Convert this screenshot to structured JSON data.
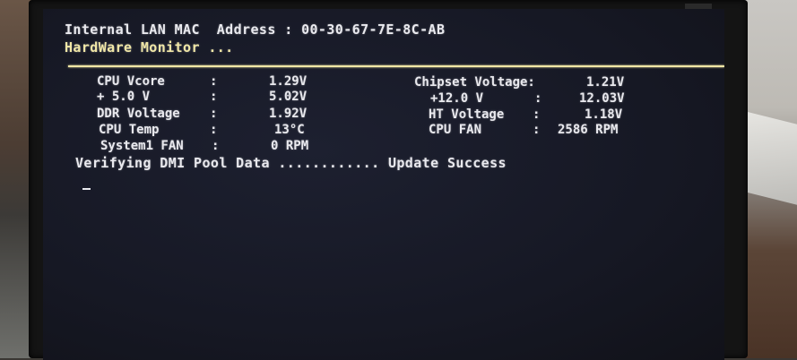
{
  "bios": {
    "mac_label": "Internal LAN MAC  Address : ",
    "mac_value": "00-30-67-7E-8C-AB",
    "section_title": "HardWare Monitor ...",
    "monitor_left": [
      {
        "label": "CPU Vcore",
        "value": "1.29V"
      },
      {
        "label": "+ 5.0 V",
        "value": "5.02V"
      },
      {
        "label": "DDR Voltage",
        "value": "1.92V"
      },
      {
        "label": "CPU Temp",
        "value": "13°C"
      },
      {
        "label": "System1 FAN",
        "value": "0 RPM"
      }
    ],
    "monitor_right": [
      {
        "label": "Chipset Voltage:",
        "value": "1.21V"
      },
      {
        "label": "+12.0 V",
        "value": "12.03V"
      },
      {
        "label": "HT Voltage",
        "value": "1.18V"
      },
      {
        "label": "CPU FAN",
        "value": "2586 RPM"
      }
    ],
    "colon": ":",
    "dmi_status": "Verifying DMI Pool Data ............ Update Success"
  },
  "colors": {
    "screen_bg": "#161824",
    "text": "#e9e9ee",
    "highlight": "#f1e7a6"
  }
}
